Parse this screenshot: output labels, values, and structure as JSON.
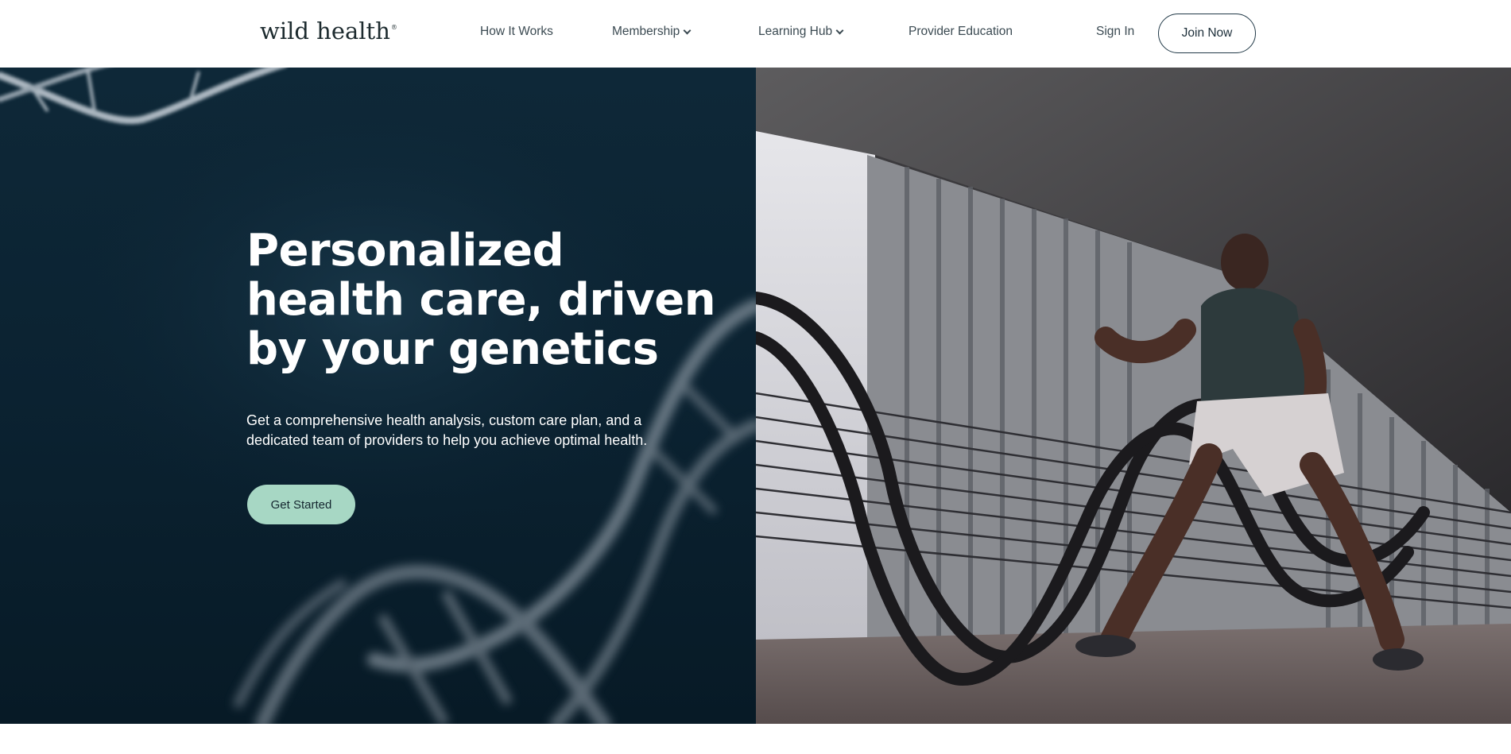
{
  "header": {
    "logo": "wild health",
    "logo_mark": "®",
    "nav": [
      {
        "label": "How It Works"
      },
      {
        "label": "Membership"
      },
      {
        "label": "Learning Hub"
      },
      {
        "label": "Provider Education"
      }
    ],
    "sign_in": "Sign In",
    "join_now": "Join Now"
  },
  "hero": {
    "title": "Personalized health care, driven by your genetics",
    "subtitle": "Get a comprehensive health analysis, custom care plan, and a dedicated team of providers to help you achieve optimal health.",
    "cta": "Get Started"
  },
  "colors": {
    "hero_bg": "#0b2231",
    "cta_bg": "#a7d7c4",
    "text_dark": "#1d2f3a"
  }
}
